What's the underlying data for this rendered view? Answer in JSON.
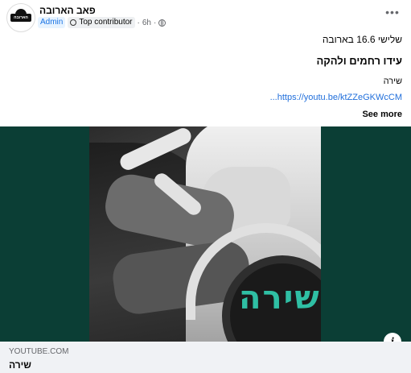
{
  "post": {
    "group_name": "פאב הארובה",
    "badges": {
      "admin": "Admin",
      "top_contributor": "Top contributor"
    },
    "time": "6h",
    "privacy_icon": "globe-icon",
    "more_icon": "more-dots-icon",
    "more_label": "•••",
    "avatar_text": "הארובה",
    "lines": {
      "date_line": "שלישי 16.6 בארובה",
      "headline": "עידו רחמים ולהקה",
      "subtitle": "שירה",
      "url": "...https://youtu.be/ktZZeGKWcCM"
    },
    "see_more": "See more"
  },
  "media": {
    "art_text": "שירה",
    "info_label": "i",
    "background": "#0b3e35",
    "art_text_color": "#2fbfa4"
  },
  "link_preview": {
    "domain": "YOUTUBE.COM",
    "title": "שירה"
  }
}
